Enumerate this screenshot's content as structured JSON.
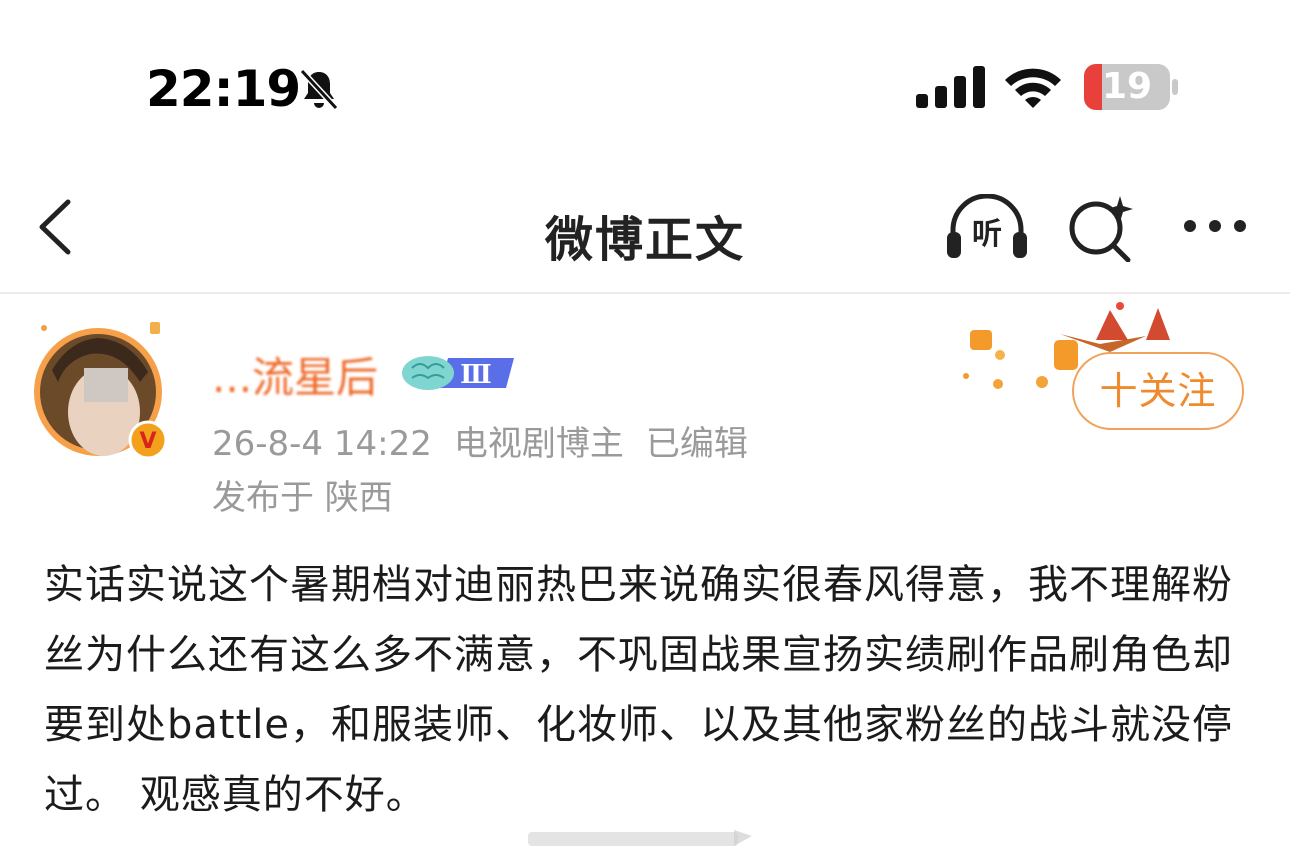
{
  "status_bar": {
    "time": "22:19",
    "battery": "19",
    "icons": [
      "bell-muted-icon",
      "signal-icon",
      "wifi-icon",
      "battery-icon"
    ],
    "battery_color": "#e8413c"
  },
  "nav": {
    "title": "微博正文",
    "listen_label": "听",
    "icons": [
      "back-chevron-icon",
      "listen-headphones-icon",
      "search-sparkle-icon",
      "more-dots-icon"
    ]
  },
  "author": {
    "name": "...流星后",
    "level": "Ⅲ",
    "verified_badge": "V",
    "time": "26-8-4 14:22",
    "role": "电视剧博主",
    "edited": "已编辑",
    "location": "发布于 陕西",
    "follow_label": "十关注",
    "accent": "#f08a2e"
  },
  "post": {
    "text": "实话实说这个暑期档对迪丽热巴来说确实很春风得意，我不理解粉丝为什么还有这么多不满意，不巩固战果宣扬实绩刷作品刷角色却要到处battle，和服装师、化妆师、以及其他家粉丝的战斗就没停过。 观感真的不好。"
  }
}
